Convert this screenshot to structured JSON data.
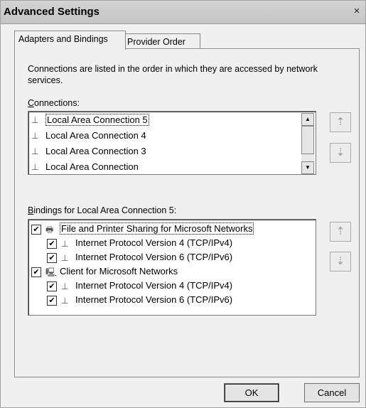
{
  "window": {
    "title": "Advanced Settings",
    "close_glyph": "×"
  },
  "tabs": [
    {
      "label": "Adapters and Bindings",
      "active": true
    },
    {
      "label": "Provider Order",
      "active": false
    }
  ],
  "description": "Connections are listed in the order in which they are accessed by network services.",
  "connections": {
    "label_mnemonic": "C",
    "label_rest": "onnections:",
    "items": [
      {
        "label": "Local Area Connection 5",
        "selected": true
      },
      {
        "label": "Local Area Connection 4",
        "selected": false
      },
      {
        "label": "Local Area Connection 3",
        "selected": false
      },
      {
        "label": "Local Area Connection",
        "selected": false
      }
    ],
    "scroll": {
      "up_glyph": "▲",
      "down_glyph": "▼"
    },
    "move_up_glyph": "⇡",
    "move_down_glyph": "⇣"
  },
  "bindings": {
    "label_mnemonic": "B",
    "label_rest": "indings for Local Area Connection 5:",
    "rows": [
      {
        "label": "File and Printer Sharing for Microsoft Networks",
        "checked": true,
        "indent": 0,
        "icon": "printer-share-icon",
        "selected": true
      },
      {
        "label": "Internet Protocol Version 4 (TCP/IPv4)",
        "checked": true,
        "indent": 1,
        "icon": "protocol-icon",
        "selected": false
      },
      {
        "label": "Internet Protocol Version 6 (TCP/IPv6)",
        "checked": true,
        "indent": 1,
        "icon": "protocol-icon",
        "selected": false
      },
      {
        "label": "Client for Microsoft Networks",
        "checked": true,
        "indent": 0,
        "icon": "network-client-icon",
        "selected": false
      },
      {
        "label": "Internet Protocol Version 4 (TCP/IPv4)",
        "checked": true,
        "indent": 1,
        "icon": "protocol-icon",
        "selected": false
      },
      {
        "label": "Internet Protocol Version 6 (TCP/IPv6)",
        "checked": true,
        "indent": 1,
        "icon": "protocol-icon",
        "selected": false
      }
    ],
    "check_glyph": "✔",
    "move_up_glyph": "⇡",
    "move_down_glyph": "⇣"
  },
  "buttons": {
    "ok": "OK",
    "cancel": "Cancel"
  }
}
